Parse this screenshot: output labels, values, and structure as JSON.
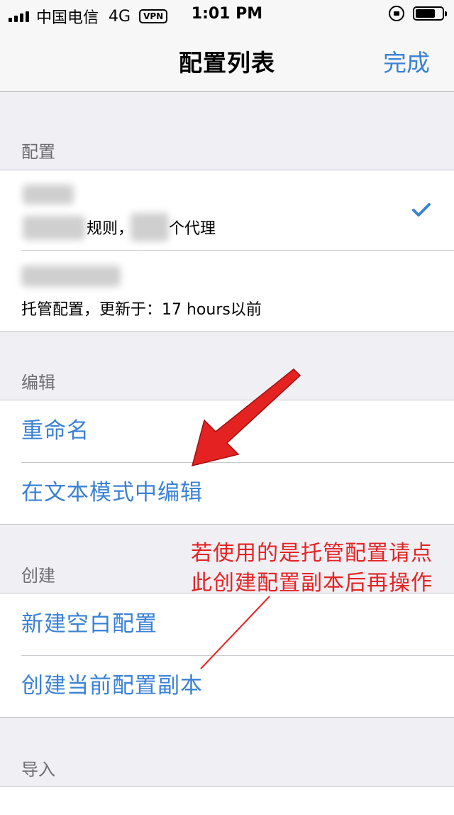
{
  "status_bar": {
    "carrier": "中国电信",
    "network": "4G",
    "vpn": "VPN",
    "time": "1:01 PM",
    "battery_level": 0.75
  },
  "nav": {
    "title": "配置列表",
    "done_label": "完成"
  },
  "sections": {
    "config": {
      "header": "配置",
      "items": [
        {
          "sub_a": "规则，",
          "sub_b": "个代理",
          "selected": true
        },
        {
          "sub": "托管配置，更新于：17 hours以前",
          "selected": false
        }
      ]
    },
    "edit": {
      "header": "编辑",
      "items": [
        "重命名",
        "在文本模式中编辑"
      ]
    },
    "create": {
      "header": "创建",
      "items": [
        "新建空白配置",
        "创建当前配置副本"
      ]
    },
    "import": {
      "header": "导入"
    }
  },
  "annotation": {
    "line1": "若使用的是托管配置请点",
    "line2": "此创建配置副本后再操作",
    "color": "#e52222"
  },
  "colors": {
    "accent": "#3b82d4",
    "background": "#efeff4"
  }
}
